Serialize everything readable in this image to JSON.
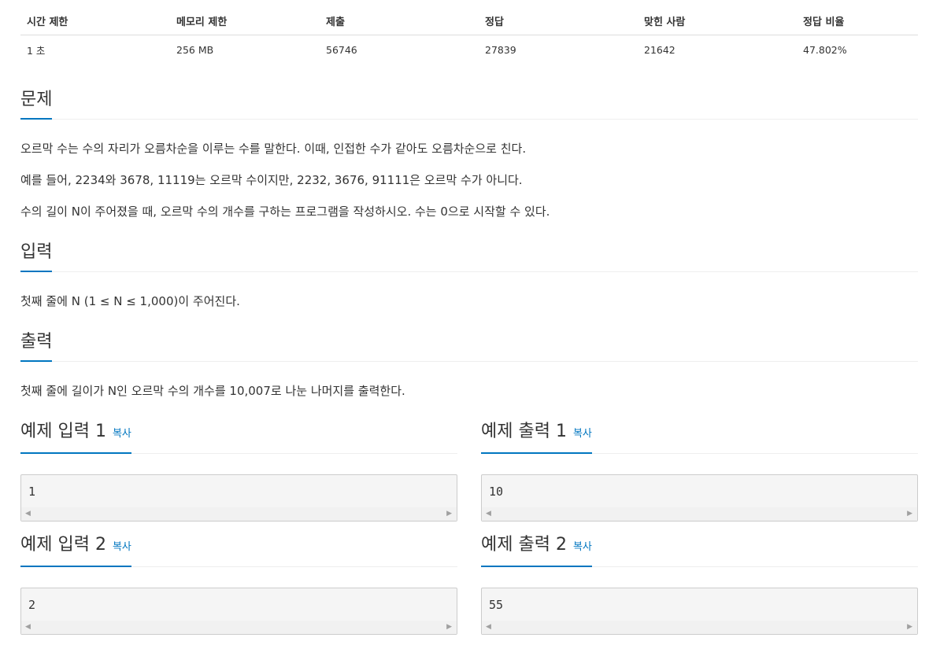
{
  "stats": {
    "headers": [
      "시간 제한",
      "메모리 제한",
      "제출",
      "정답",
      "맞힌 사람",
      "정답 비율"
    ],
    "values": [
      "1 초",
      "256 MB",
      "56746",
      "27839",
      "21642",
      "47.802%"
    ]
  },
  "problem": {
    "title": "문제",
    "paragraphs": [
      "오르막 수는 수의 자리가 오름차순을 이루는 수를 말한다. 이때, 인접한 수가 같아도 오름차순으로 친다.",
      "예를 들어, 2234와 3678, 11119는 오르막 수이지만, 2232, 3676, 91111은 오르막 수가 아니다.",
      "수의 길이 N이 주어졌을 때, 오르막 수의 개수를 구하는 프로그램을 작성하시오. 수는 0으로 시작할 수 있다."
    ]
  },
  "input": {
    "title": "입력",
    "text": "첫째 줄에 N (1 ≤ N ≤ 1,000)이 주어진다."
  },
  "output": {
    "title": "출력",
    "text": "첫째 줄에 길이가 N인 오르막 수의 개수를 10,007로 나눈 나머지를 출력한다."
  },
  "samples": [
    {
      "title": "예제 입력 1",
      "copy": "복사",
      "value": "1"
    },
    {
      "title": "예제 출력 1",
      "copy": "복사",
      "value": "10"
    },
    {
      "title": "예제 입력 2",
      "copy": "복사",
      "value": "2"
    },
    {
      "title": "예제 출력 2",
      "copy": "복사",
      "value": "55"
    }
  ],
  "icons": {
    "scroll_left": "triangle-left-icon",
    "scroll_right": "triangle-right-icon"
  },
  "colors": {
    "accent": "#0076c0"
  }
}
